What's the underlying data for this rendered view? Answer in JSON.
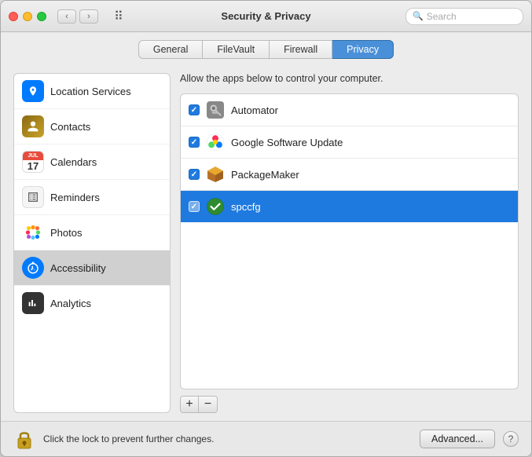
{
  "window": {
    "title": "Security & Privacy"
  },
  "titlebar": {
    "back_label": "‹",
    "forward_label": "›",
    "search_placeholder": "Search",
    "grid_icon": "⊞"
  },
  "tabs": [
    {
      "id": "general",
      "label": "General",
      "active": false
    },
    {
      "id": "filevault",
      "label": "FileVault",
      "active": false
    },
    {
      "id": "firewall",
      "label": "Firewall",
      "active": false
    },
    {
      "id": "privacy",
      "label": "Privacy",
      "active": true
    }
  ],
  "sidebar": {
    "items": [
      {
        "id": "location-services",
        "label": "Location Services",
        "icon_type": "location"
      },
      {
        "id": "contacts",
        "label": "Contacts",
        "icon_type": "contacts"
      },
      {
        "id": "calendars",
        "label": "Calendars",
        "icon_type": "calendars",
        "cal_month": "JUL",
        "cal_day": "17"
      },
      {
        "id": "reminders",
        "label": "Reminders",
        "icon_type": "reminders"
      },
      {
        "id": "photos",
        "label": "Photos",
        "icon_type": "photos"
      },
      {
        "id": "accessibility",
        "label": "Accessibility",
        "icon_type": "accessibility",
        "selected": true
      },
      {
        "id": "analytics",
        "label": "Analytics",
        "icon_type": "analytics"
      }
    ]
  },
  "panel": {
    "description": "Allow the apps below to control your computer.",
    "apps": [
      {
        "id": "automator",
        "name": "Automator",
        "checked": true,
        "selected": false,
        "icon": "🤖"
      },
      {
        "id": "google-software-update",
        "name": "Google Software Update",
        "checked": true,
        "selected": false,
        "icon": "🎱"
      },
      {
        "id": "packagemaker",
        "name": "PackageMaker",
        "checked": true,
        "selected": false,
        "icon": "📦"
      },
      {
        "id": "spccfg",
        "name": "spccfg",
        "checked": true,
        "selected": true,
        "icon": "🛡"
      }
    ],
    "add_button": "+",
    "remove_button": "−"
  },
  "bottombar": {
    "lock_text": "Click the lock to prevent further changes.",
    "advanced_button": "Advanced...",
    "help_button": "?"
  }
}
